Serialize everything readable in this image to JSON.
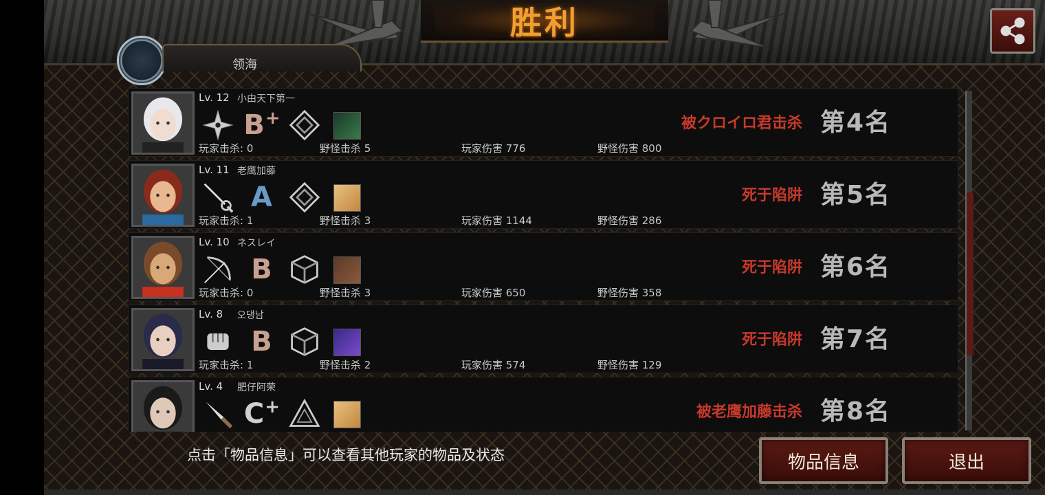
{
  "header": {
    "title": "胜利",
    "player_tab_label": "领海"
  },
  "players": [
    {
      "level": "Lv. 12",
      "name": "小由天下第一",
      "weapon_icon": "shuriken-icon",
      "grade": "B",
      "grade_plus": "+",
      "emblem_icon": "diamond-emblem-icon",
      "item_icon": "soldier-item-icon",
      "stats": {
        "player_kills": "玩家击杀: 0",
        "monster_kills": "野怪击杀 5",
        "player_damage": "玩家伤害 776",
        "monster_damage": "野怪伤害 800"
      },
      "death": "被クロイロ君击杀",
      "rank": "第4名",
      "portrait_colors": {
        "hair": "#e8e8ec",
        "skin": "#f0dcd0",
        "accent": "#222"
      }
    },
    {
      "level": "Lv. 11",
      "name": "老鹰加藤",
      "weapon_icon": "rapier-icon",
      "grade": "A",
      "grade_plus": "",
      "emblem_icon": "diamond-emblem-icon",
      "item_icon": "bread-item-icon",
      "stats": {
        "player_kills": "玩家击杀: 1",
        "monster_kills": "野怪击杀 3",
        "player_damage": "玩家伤害 1144",
        "monster_damage": "野怪伤害 286"
      },
      "death": "死于陷阱",
      "rank": "第5名",
      "portrait_colors": {
        "hair": "#8a2a1a",
        "skin": "#e8b890",
        "accent": "#2a6aa0"
      }
    },
    {
      "level": "Lv. 10",
      "name": "ネスレイ",
      "weapon_icon": "bow-icon",
      "grade": "B",
      "grade_plus": "",
      "emblem_icon": "cube-emblem-icon",
      "item_icon": "crossed-blades-item-icon",
      "stats": {
        "player_kills": "玩家击杀: 0",
        "monster_kills": "野怪击杀 3",
        "player_damage": "玩家伤害 650",
        "monster_damage": "野怪伤害 358"
      },
      "death": "死于陷阱",
      "rank": "第6名",
      "portrait_colors": {
        "hair": "#7a4a2a",
        "skin": "#d8a878",
        "accent": "#c83020"
      }
    },
    {
      "level": "Lv. 8",
      "name": "오댕남",
      "weapon_icon": "fist-icon",
      "grade": "B",
      "grade_plus": "",
      "emblem_icon": "cube-emblem-icon",
      "item_icon": "purple-creature-item-icon",
      "stats": {
        "player_kills": "玩家击杀: 1",
        "monster_kills": "野怪击杀 2",
        "player_damage": "玩家伤害 574",
        "monster_damage": "野怪伤害 129"
      },
      "death": "死于陷阱",
      "rank": "第7名",
      "portrait_colors": {
        "hair": "#2a2a4a",
        "skin": "#e8d0c0",
        "accent": "#1a1a2a"
      }
    },
    {
      "level": "Lv. 4",
      "name": "肥仔阿荣",
      "weapon_icon": "knife-icon",
      "grade": "C",
      "grade_plus": "+",
      "emblem_icon": "triangle-emblem-icon",
      "item_icon": "bread-item-icon",
      "stats": {
        "player_kills": "",
        "monster_kills": "",
        "player_damage": "",
        "monster_damage": ""
      },
      "death": "被老鹰加藤击杀",
      "rank": "第8名",
      "portrait_colors": {
        "hair": "#1a1a1a",
        "skin": "#e0c8b8",
        "accent": "#333"
      }
    }
  ],
  "grade_colors": {
    "A": "#6a9ac8",
    "B": "#c8a090",
    "C": "#d0d0d0"
  },
  "scrollbar": {
    "thumb_start": 0.3,
    "thumb_end": 0.78
  },
  "footer": {
    "hint": "点击「物品信息」可以查看其他玩家的物品及状态",
    "item_info_button": "物品信息",
    "exit_button": "退出"
  },
  "icons": {
    "share": "share-icon"
  }
}
